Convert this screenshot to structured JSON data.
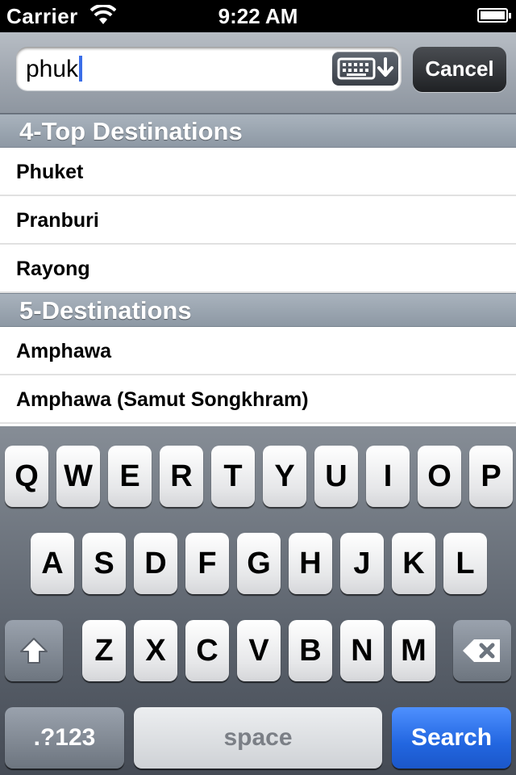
{
  "status_bar": {
    "carrier": "Carrier",
    "time": "9:22 AM"
  },
  "search": {
    "value": "phuk",
    "cancel_label": "Cancel"
  },
  "sections": [
    {
      "title": "4-Top Destinations",
      "rows": [
        "Phuket",
        "Pranburi",
        "Rayong"
      ]
    },
    {
      "title": "5-Destinations",
      "rows": [
        "Amphawa",
        "Amphawa (Samut Songkhram)"
      ]
    }
  ],
  "keyboard": {
    "row1": [
      "Q",
      "W",
      "E",
      "R",
      "T",
      "Y",
      "U",
      "I",
      "O",
      "P"
    ],
    "row2": [
      "A",
      "S",
      "D",
      "F",
      "G",
      "H",
      "J",
      "K",
      "L"
    ],
    "row3": [
      "Z",
      "X",
      "C",
      "V",
      "B",
      "N",
      "M"
    ],
    "numbers_label": ".?123",
    "space_label": "space",
    "search_label": "Search",
    "shift_icon": "shift-icon",
    "delete_icon": "backspace-icon"
  },
  "colors": {
    "search_key": "#2266e0",
    "caret": "#3b6ee8"
  }
}
